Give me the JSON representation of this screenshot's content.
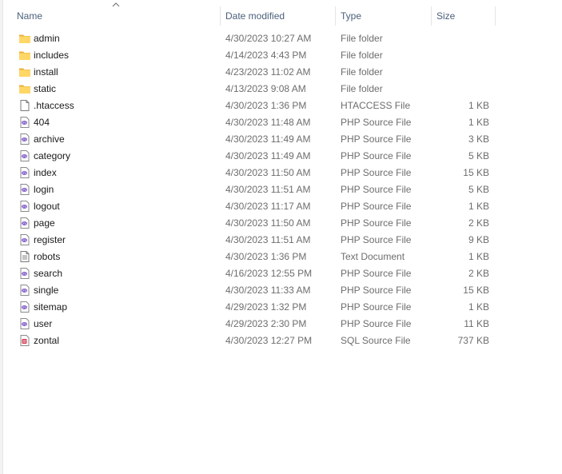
{
  "columns": {
    "name": "Name",
    "date": "Date modified",
    "type": "Type",
    "size": "Size"
  },
  "files": [
    {
      "name": "admin",
      "date": "4/30/2023 10:27 AM",
      "type": "File folder",
      "size": "",
      "icon": "folder-icon"
    },
    {
      "name": "includes",
      "date": "4/14/2023 4:43 PM",
      "type": "File folder",
      "size": "",
      "icon": "folder-icon"
    },
    {
      "name": "install",
      "date": "4/23/2023 11:02 AM",
      "type": "File folder",
      "size": "",
      "icon": "folder-icon"
    },
    {
      "name": "static",
      "date": "4/13/2023 9:08 AM",
      "type": "File folder",
      "size": "",
      "icon": "folder-icon"
    },
    {
      "name": ".htaccess",
      "date": "4/30/2023 1:36 PM",
      "type": "HTACCESS File",
      "size": "1 KB",
      "icon": "blank-file-icon"
    },
    {
      "name": "404",
      "date": "4/30/2023 11:48 AM",
      "type": "PHP Source File",
      "size": "1 KB",
      "icon": "php-file-icon"
    },
    {
      "name": "archive",
      "date": "4/30/2023 11:49 AM",
      "type": "PHP Source File",
      "size": "3 KB",
      "icon": "php-file-icon"
    },
    {
      "name": "category",
      "date": "4/30/2023 11:49 AM",
      "type": "PHP Source File",
      "size": "5 KB",
      "icon": "php-file-icon"
    },
    {
      "name": "index",
      "date": "4/30/2023 11:50 AM",
      "type": "PHP Source File",
      "size": "15 KB",
      "icon": "php-file-icon"
    },
    {
      "name": "login",
      "date": "4/30/2023 11:51 AM",
      "type": "PHP Source File",
      "size": "5 KB",
      "icon": "php-file-icon"
    },
    {
      "name": "logout",
      "date": "4/30/2023 11:17 AM",
      "type": "PHP Source File",
      "size": "1 KB",
      "icon": "php-file-icon"
    },
    {
      "name": "page",
      "date": "4/30/2023 11:50 AM",
      "type": "PHP Source File",
      "size": "2 KB",
      "icon": "php-file-icon"
    },
    {
      "name": "register",
      "date": "4/30/2023 11:51 AM",
      "type": "PHP Source File",
      "size": "9 KB",
      "icon": "php-file-icon"
    },
    {
      "name": "robots",
      "date": "4/30/2023 1:36 PM",
      "type": "Text Document",
      "size": "1 KB",
      "icon": "text-file-icon"
    },
    {
      "name": "search",
      "date": "4/16/2023 12:55 PM",
      "type": "PHP Source File",
      "size": "2 KB",
      "icon": "php-file-icon"
    },
    {
      "name": "single",
      "date": "4/30/2023 11:33 AM",
      "type": "PHP Source File",
      "size": "15 KB",
      "icon": "php-file-icon"
    },
    {
      "name": "sitemap",
      "date": "4/29/2023 1:32 PM",
      "type": "PHP Source File",
      "size": "1 KB",
      "icon": "php-file-icon"
    },
    {
      "name": "user",
      "date": "4/29/2023 2:30 PM",
      "type": "PHP Source File",
      "size": "11 KB",
      "icon": "php-file-icon"
    },
    {
      "name": "zontal",
      "date": "4/30/2023 12:27 PM",
      "type": "SQL Source File",
      "size": "737 KB",
      "icon": "sql-file-icon"
    }
  ],
  "colors": {
    "folder": "#ffd766",
    "folder_dark": "#e8b23a",
    "php": "#7a52c7",
    "sql": "#d63a52",
    "header_text": "#4c607a"
  }
}
